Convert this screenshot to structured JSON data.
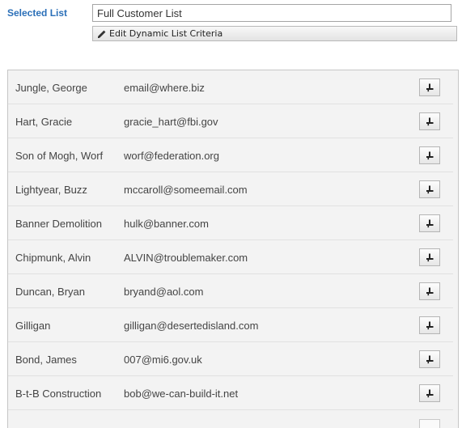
{
  "selected_list": {
    "label": "Selected List",
    "value": "Full Customer List"
  },
  "edit_button": {
    "label": "Edit Dynamic List Criteria",
    "icon": "pencil-icon"
  },
  "contacts": [
    {
      "name": "Jungle, George",
      "email": "email@where.biz"
    },
    {
      "name": "Hart, Gracie",
      "email": "gracie_hart@fbi.gov"
    },
    {
      "name": "Son of Mogh, Worf",
      "email": "worf@federation.org"
    },
    {
      "name": "Lightyear, Buzz",
      "email": "mccaroll@someemail.com"
    },
    {
      "name": "Banner Demolition",
      "email": "hulk@banner.com"
    },
    {
      "name": "Chipmunk, Alvin",
      "email": "ALVIN@troublemaker.com"
    },
    {
      "name": "Duncan, Bryan",
      "email": "bryand@aol.com"
    },
    {
      "name": "Gilligan",
      "email": "gilligan@desertedisland.com"
    },
    {
      "name": "Bond, James",
      "email": "007@mi6.gov.uk"
    },
    {
      "name": "B-t-B Construction",
      "email": "bob@we-can-build-it.net"
    }
  ],
  "row_action_icon": "remove-from-list-icon"
}
